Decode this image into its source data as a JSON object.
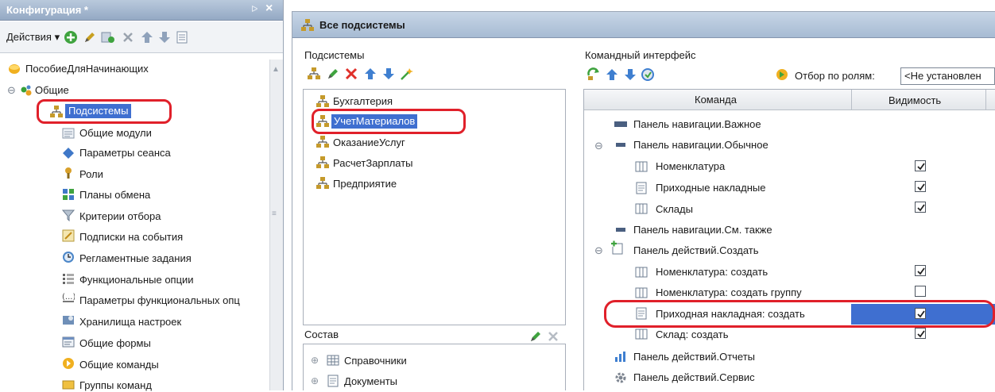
{
  "left_panel": {
    "title": "Конфигурация *",
    "pin_glyph": "ᐅ",
    "close_glyph": "×",
    "actions_label": "Действия ▾",
    "tree": {
      "root": "ПособиеДляНачинающих",
      "common": "Общие",
      "items": [
        "Подсистемы",
        "Общие модули",
        "Параметры сеанса",
        "Роли",
        "Планы обмена",
        "Критерии отбора",
        "Подписки на события",
        "Регламентные задания",
        "Функциональные опции",
        "Параметры функциональных опц",
        "Хранилища настроек",
        "Общие формы",
        "Общие команды",
        "Группы команд"
      ]
    }
  },
  "right_window": {
    "title": "Все подсистемы",
    "subsystems": {
      "label": "Подсистемы",
      "items": [
        "Бухгалтерия",
        "УчетМатериалов",
        "ОказаниеУслуг",
        "РасчетЗарплаты",
        "Предприятие"
      ]
    },
    "composition": {
      "label": "Состав",
      "items": [
        "Справочники",
        "Документы"
      ]
    },
    "command_interface": {
      "label": "Командный интерфейс",
      "role_filter_label": "Отбор по ролям:",
      "role_filter_value": "<Не установлен",
      "columns": [
        "Команда",
        "Видимость"
      ],
      "rows": [
        {
          "text": "Панель навигации.Важное",
          "checked": null
        },
        {
          "text": "Панель навигации.Обычное",
          "checked": null
        },
        {
          "text": "Номенклатура",
          "checked": true
        },
        {
          "text": "Приходные накладные",
          "checked": true
        },
        {
          "text": "Склады",
          "checked": true
        },
        {
          "text": "Панель навигации.См. также",
          "checked": null
        },
        {
          "text": "Панель действий.Создать",
          "checked": null
        },
        {
          "text": "Номенклатура: создать",
          "checked": true
        },
        {
          "text": "Номенклатура: создать группу",
          "checked": false
        },
        {
          "text": "Приходная накладная: создать",
          "checked": true
        },
        {
          "text": "Склад: создать",
          "checked": true
        },
        {
          "text": "Панель действий.Отчеты",
          "checked": null
        },
        {
          "text": "Панель действий.Сервис",
          "checked": null
        }
      ]
    }
  },
  "colors": {
    "selection": "#3f6fd0",
    "highlight": "#e0202a",
    "title_bar": "#a7bbd3"
  }
}
